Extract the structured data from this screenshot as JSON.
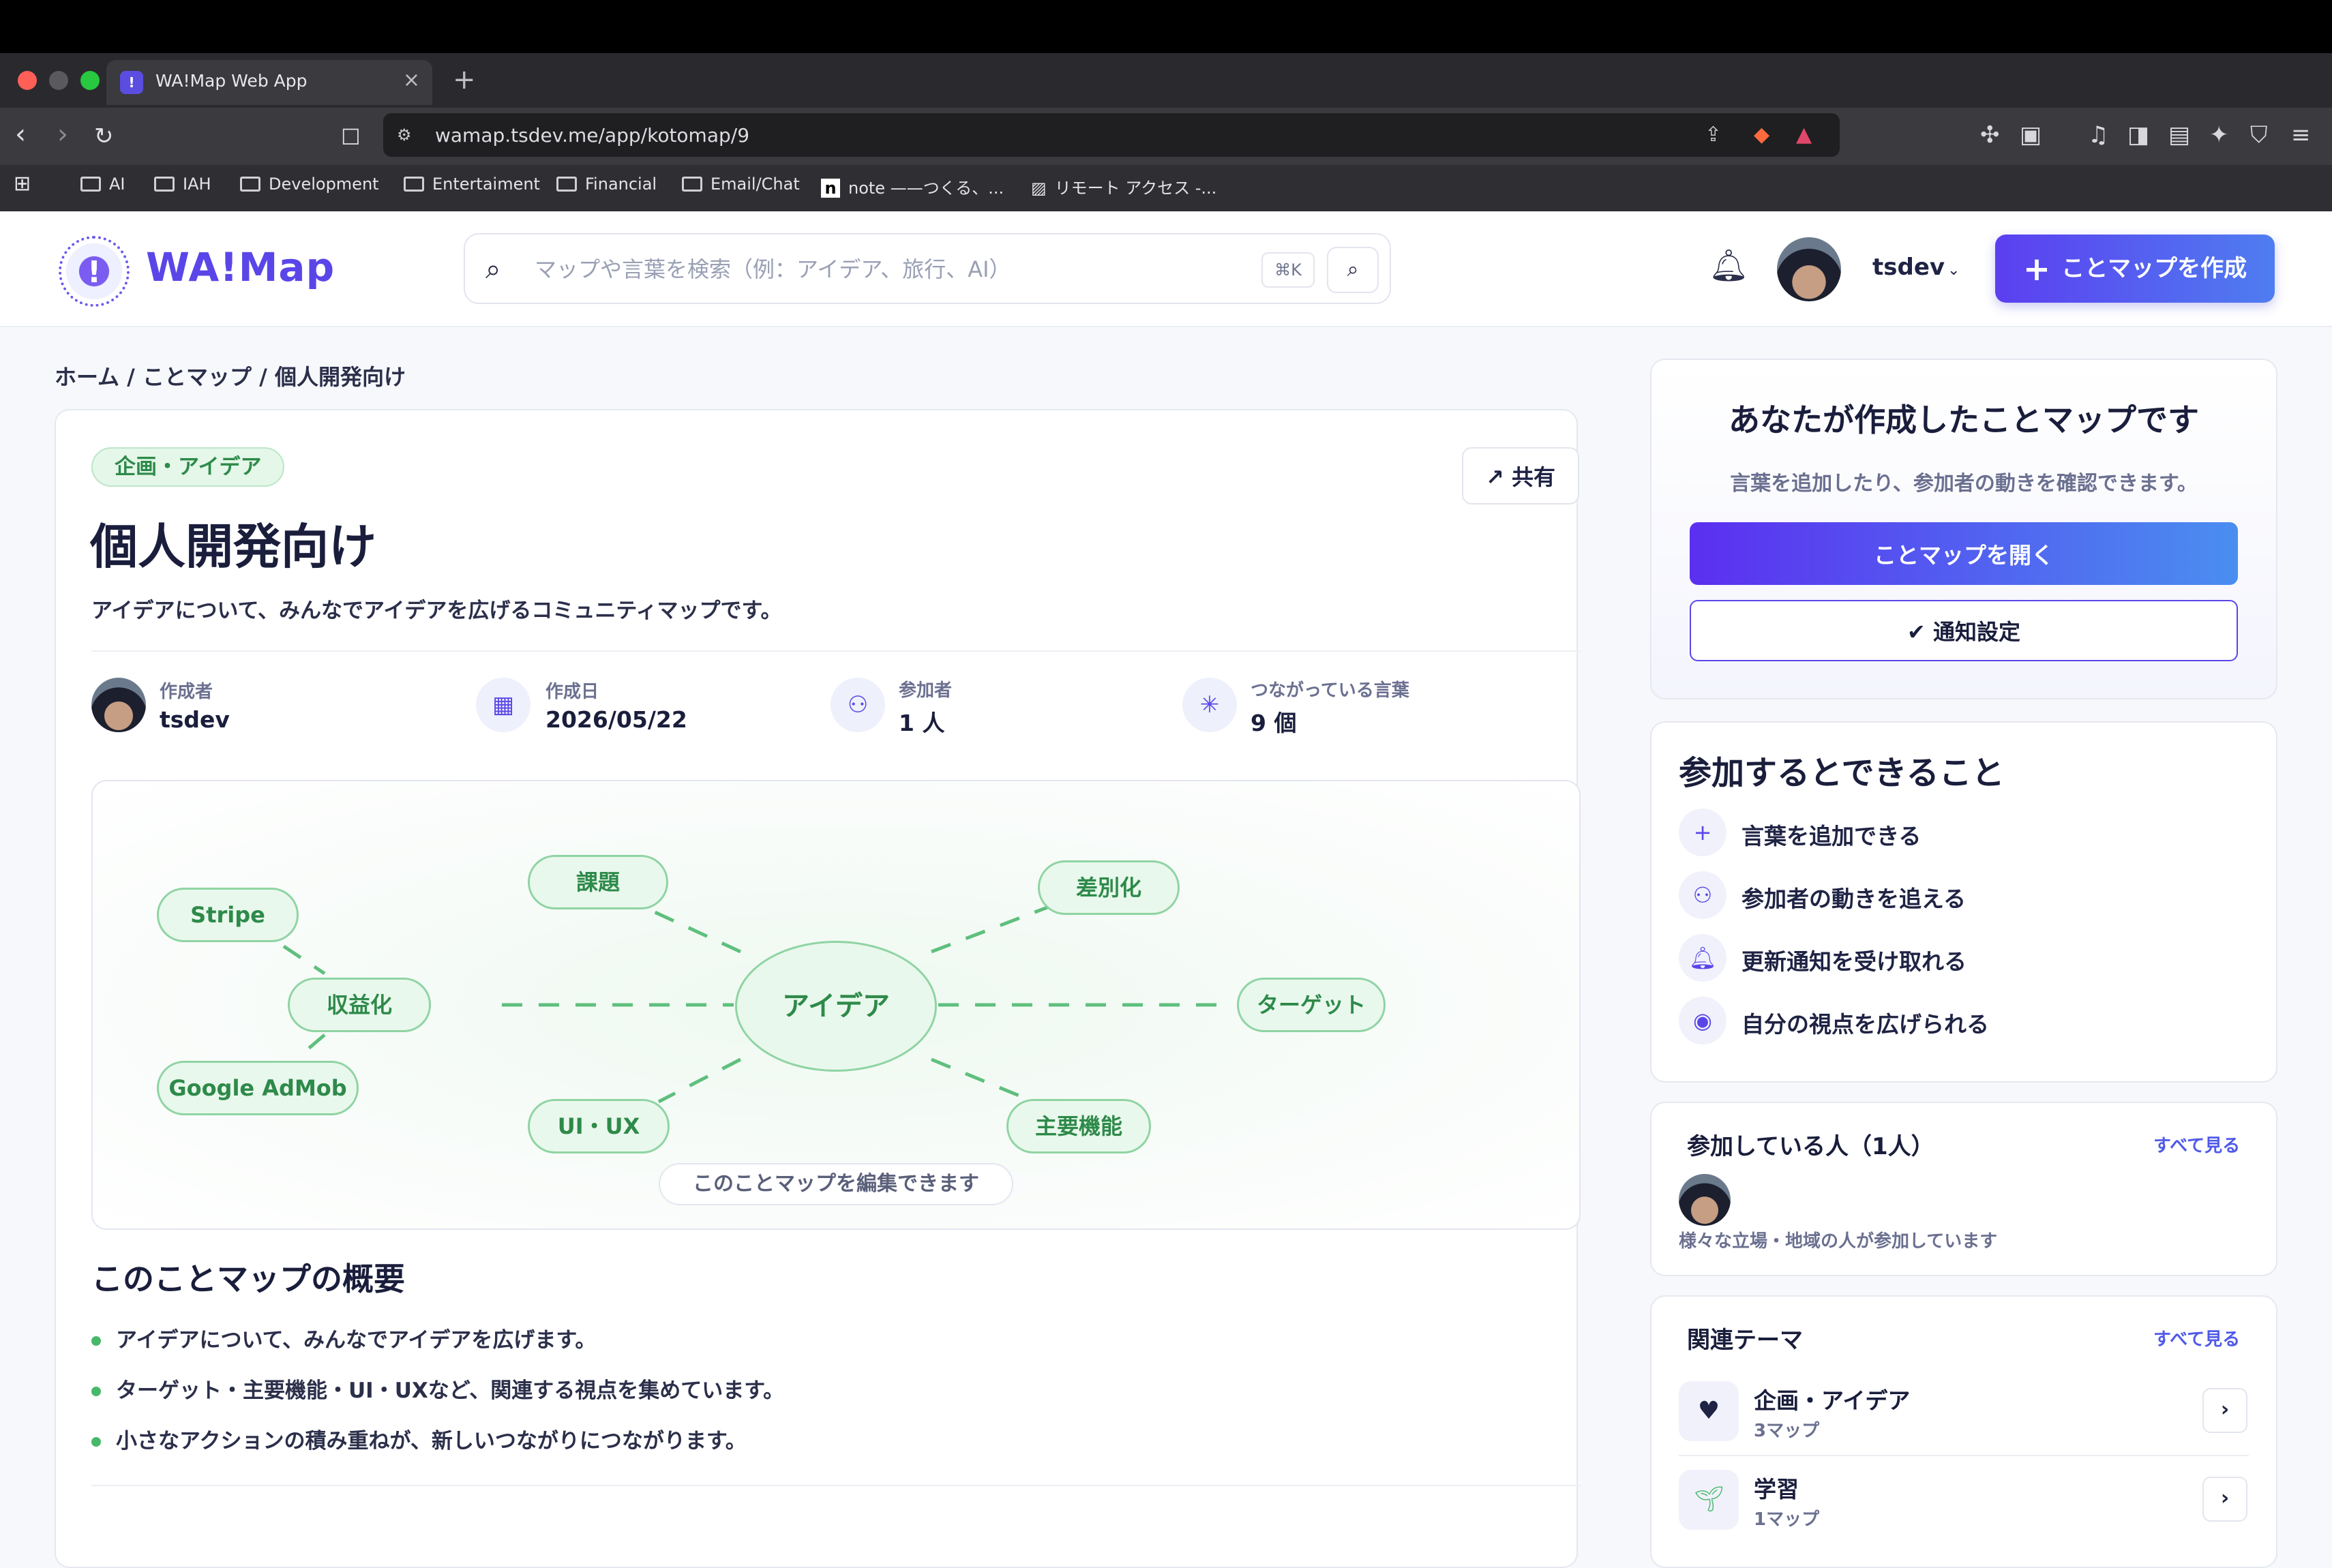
{
  "browser": {
    "tab_title": "WA!Map Web App",
    "url": "wamap.tsdev.me/app/kotomap/9",
    "bookmarks": [
      "AI",
      "IAH",
      "Development",
      "Entertaiment",
      "Financial",
      "Email/Chat",
      "note ——つくる、...",
      "リモート アクセス -..."
    ]
  },
  "header": {
    "logo": "WA!Map",
    "search_placeholder": "マップや言葉を検索（例：アイデア、旅行、AI）",
    "search_shortcut": "⌘K",
    "username": "tsdev",
    "create_label": "ことマップを作成"
  },
  "breadcrumb": "ホーム / ことマップ / 個人開発向け",
  "map": {
    "category": "企画・アイデア",
    "share_label": "↗ 共有",
    "title": "個人開発向け",
    "description": "アイデアについて、みんなでアイデアを広げるコミュニティマップです。",
    "meta": [
      {
        "label": "作成者",
        "value": "tsdev"
      },
      {
        "label": "作成日",
        "value": "2026/05/22"
      },
      {
        "label": "参加者",
        "value": "1 人"
      },
      {
        "label": "つながっている言葉",
        "value": "9 個"
      }
    ],
    "nodes": {
      "center": "アイデア",
      "kadai": "課題",
      "sabetsuka": "差別化",
      "target": "ターゲット",
      "shuyo": "主要機能",
      "uiux": "UI・UX",
      "shuekika": "収益化",
      "stripe": "Stripe",
      "admob": "Google AdMob"
    },
    "edit_note": "このことマップを編集できます"
  },
  "overview": {
    "title": "このことマップの概要",
    "bullets": [
      "アイデアについて、みんなでアイデアを広げます。",
      "ターゲット・主要機能・UI・UXなど、関連する視点を集めています。",
      "小さなアクションの積み重ねが、新しいつながりにつながります。"
    ]
  },
  "sidebar": {
    "owner": {
      "title": "あなたが作成したことマップです",
      "subtitle": "言葉を追加したり、参加者の動きを確認できます。",
      "open_label": "ことマップを開く",
      "notify_label": "✔ 通知設定"
    },
    "can_do": {
      "title": "参加するとできること",
      "items": [
        "言葉を追加できる",
        "参加者の動きを追える",
        "更新通知を受け取れる",
        "自分の視点を広げられる"
      ]
    },
    "people": {
      "title": "参加している人（1人）",
      "see_all": "すべて見る",
      "subtitle": "様々な立場・地域の人が参加しています"
    },
    "related": {
      "title": "関連テーマ",
      "see_all": "すべて見る",
      "items": [
        {
          "name": "企画・アイデア",
          "count": "3マップ"
        },
        {
          "name": "学習",
          "count": "1マップ"
        }
      ]
    }
  }
}
